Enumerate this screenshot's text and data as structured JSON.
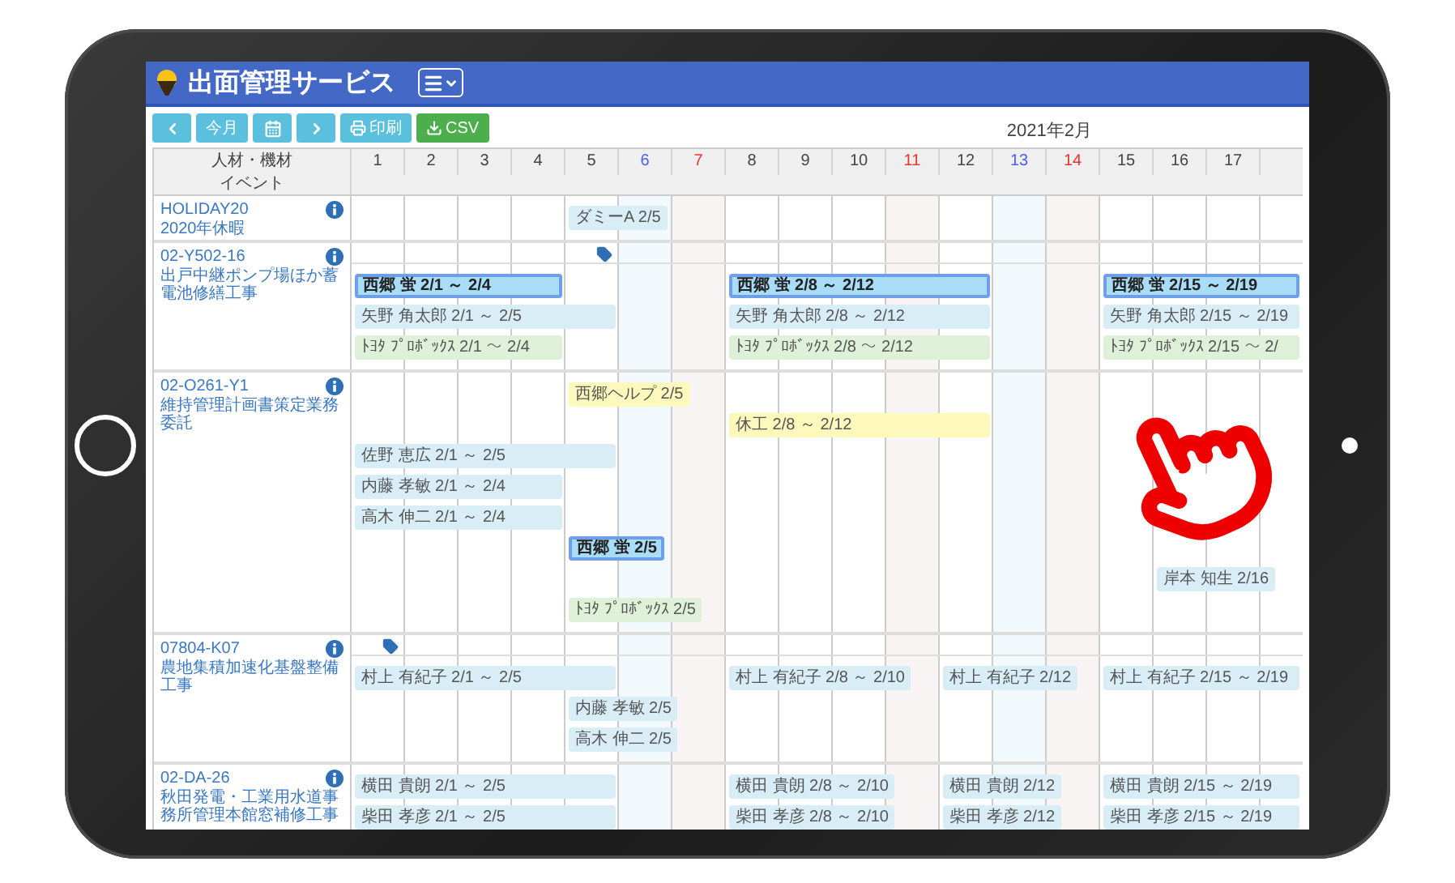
{
  "app": {
    "title": "出面管理サービス"
  },
  "toolbar": {
    "buttons": [
      {
        "kind": "prev"
      },
      {
        "kind": "text",
        "label": "今月"
      },
      {
        "kind": "calendar"
      },
      {
        "kind": "next"
      },
      {
        "kind": "print",
        "label": "印刷"
      },
      {
        "kind": "csv",
        "label": "CSV"
      }
    ],
    "month": "2021年2月"
  },
  "table": {
    "resource_header": "人材・機材",
    "event_header": "イベント",
    "days": [
      {
        "label": "1",
        "kind": "weekday"
      },
      {
        "label": "2",
        "kind": "weekday"
      },
      {
        "label": "3",
        "kind": "weekday"
      },
      {
        "label": "4",
        "kind": "weekday"
      },
      {
        "label": "5",
        "kind": "weekday"
      },
      {
        "label": "6",
        "kind": "saturday"
      },
      {
        "label": "7",
        "kind": "sunday"
      },
      {
        "label": "8",
        "kind": "weekday"
      },
      {
        "label": "9",
        "kind": "weekday"
      },
      {
        "label": "10",
        "kind": "weekday"
      },
      {
        "label": "11",
        "kind": "holiday"
      },
      {
        "label": "12",
        "kind": "weekday"
      },
      {
        "label": "13",
        "kind": "saturday"
      },
      {
        "label": "14",
        "kind": "sunday"
      },
      {
        "label": "15",
        "kind": "weekday"
      },
      {
        "label": "16",
        "kind": "weekday"
      },
      {
        "label": "17",
        "kind": "weekday"
      }
    ],
    "projects": [
      {
        "code": "HOLIDAY20",
        "name": "2020年休暇",
        "lanes": [
          [
            {
              "kind": "gap"
            },
            {
              "kind": "gap"
            },
            {
              "kind": "gap"
            },
            {
              "kind": "gap"
            },
            {
              "text": "ダミーA 2/5",
              "kind": "staff"
            }
          ]
        ]
      },
      {
        "code": "02-Y502-16",
        "name": "出戸中継ポンプ場ほか蓄電池修繕工事",
        "tag_row": [
          {
            "kind": "gap"
          },
          {
            "kind": "gap"
          },
          {
            "kind": "gap"
          },
          {
            "kind": "gap"
          },
          {
            "kind": "tag"
          }
        ],
        "lanes": [
          [
            {
              "text": "西郷 蛍 2/1 ～ 2/4",
              "kind": "lead"
            },
            {
              "kind": "continued"
            },
            {
              "kind": "continued"
            },
            {
              "kind": "continued"
            },
            {
              "kind": "gap"
            },
            {
              "kind": "gap"
            },
            {
              "kind": "gap"
            },
            {
              "text": "西郷 蛍 2/8 ～ 2/12",
              "kind": "lead"
            },
            {
              "kind": "continued"
            },
            {
              "kind": "continued"
            },
            {
              "kind": "continued"
            },
            {
              "kind": "continued"
            },
            {
              "kind": "gap"
            },
            {
              "kind": "gap"
            },
            {
              "text": "西郷 蛍 2/15 ～ 2/19",
              "kind": "lead"
            },
            {
              "kind": "continued"
            },
            {
              "kind": "continued"
            },
            {
              "kind": "continued"
            }
          ],
          [
            {
              "text": "矢野 角太郎 2/1 ～ 2/5",
              "kind": "staff"
            },
            {
              "kind": "continued"
            },
            {
              "kind": "continued"
            },
            {
              "kind": "continued"
            },
            {
              "kind": "continued"
            },
            {
              "kind": "gap"
            },
            {
              "kind": "gap"
            },
            {
              "text": "矢野 角太郎 2/8 ～ 2/12",
              "kind": "staff"
            },
            {
              "kind": "continued"
            },
            {
              "kind": "continued"
            },
            {
              "kind": "continued"
            },
            {
              "kind": "continued"
            },
            {
              "kind": "gap"
            },
            {
              "kind": "gap"
            },
            {
              "text": "矢野 角太郎 2/15 ～ 2/19",
              "kind": "staff"
            },
            {
              "kind": "continued"
            },
            {
              "kind": "continued"
            },
            {
              "kind": "continued"
            }
          ],
          [
            {
              "text": "ﾄﾖﾀ ﾌﾟﾛﾎﾞｯｸｽ 2/1 ～ 2/4",
              "kind": "equipment"
            },
            {
              "kind": "continued"
            },
            {
              "kind": "continued"
            },
            {
              "kind": "continued"
            },
            {
              "kind": "gap"
            },
            {
              "kind": "gap"
            },
            {
              "kind": "gap"
            },
            {
              "text": "ﾄﾖﾀ ﾌﾟﾛﾎﾞｯｸｽ 2/8 ～ 2/12",
              "kind": "equipment"
            },
            {
              "kind": "continued"
            },
            {
              "kind": "continued"
            },
            {
              "kind": "continued"
            },
            {
              "kind": "continued"
            },
            {
              "kind": "gap"
            },
            {
              "kind": "gap"
            },
            {
              "text": "ﾄﾖﾀ ﾌﾟﾛﾎﾞｯｸｽ 2/15 ～ 2/",
              "kind": "equipment"
            },
            {
              "kind": "continued"
            },
            {
              "kind": "continued"
            },
            {
              "kind": "continued"
            }
          ]
        ]
      },
      {
        "code": "02-O261-Y1",
        "name": "維持管理計画書策定業務委託",
        "lanes": [
          [
            {
              "kind": "gap"
            },
            {
              "kind": "gap"
            },
            {
              "kind": "gap"
            },
            {
              "kind": "gap"
            },
            {
              "text": "西郷ヘルプ 2/5",
              "kind": "notice"
            }
          ],
          [
            {
              "kind": "gap"
            },
            {
              "kind": "gap"
            },
            {
              "kind": "gap"
            },
            {
              "kind": "gap"
            },
            {
              "kind": "gap"
            },
            {
              "kind": "gap"
            },
            {
              "kind": "gap"
            },
            {
              "text": "休工 2/8 ～ 2/12",
              "kind": "notice"
            },
            {
              "kind": "continued"
            },
            {
              "kind": "continued"
            },
            {
              "kind": "continued"
            },
            {
              "kind": "continued"
            }
          ],
          [
            {
              "text": "佐野 恵広 2/1 ～ 2/5",
              "kind": "staff"
            },
            {
              "kind": "continued"
            },
            {
              "kind": "continued"
            },
            {
              "kind": "continued"
            },
            {
              "kind": "continued"
            }
          ],
          [
            {
              "text": "内藤 孝敏 2/1 ～ 2/4",
              "kind": "staff"
            },
            {
              "kind": "continued"
            },
            {
              "kind": "continued"
            },
            {
              "kind": "continued"
            }
          ],
          [
            {
              "text": "高木 伸二 2/1 ～ 2/4",
              "kind": "staff"
            },
            {
              "kind": "continued"
            },
            {
              "kind": "continued"
            },
            {
              "kind": "continued"
            }
          ],
          [
            {
              "kind": "gap"
            },
            {
              "kind": "gap"
            },
            {
              "kind": "gap"
            },
            {
              "kind": "gap"
            },
            {
              "text": "西郷 蛍 2/5",
              "kind": "lead"
            }
          ],
          [
            {
              "kind": "gap"
            },
            {
              "kind": "gap"
            },
            {
              "kind": "gap"
            },
            {
              "kind": "gap"
            },
            {
              "kind": "gap"
            },
            {
              "kind": "gap"
            },
            {
              "kind": "gap"
            },
            {
              "kind": "gap"
            },
            {
              "kind": "gap"
            },
            {
              "kind": "gap"
            },
            {
              "kind": "gap"
            },
            {
              "kind": "gap"
            },
            {
              "kind": "gap"
            },
            {
              "kind": "gap"
            },
            {
              "kind": "gap"
            },
            {
              "text": "岸本 知生 2/16",
              "kind": "staff"
            }
          ],
          [
            {
              "kind": "gap"
            },
            {
              "kind": "gap"
            },
            {
              "kind": "gap"
            },
            {
              "kind": "gap"
            },
            {
              "text": "ﾄﾖﾀ ﾌﾟﾛﾎﾞｯｸｽ 2/5",
              "kind": "equipment"
            }
          ]
        ]
      },
      {
        "code": "07804-K07",
        "name": "農地集積加速化基盤整備工事",
        "tag_row": [
          {
            "kind": "tag"
          }
        ],
        "lanes": [
          [
            {
              "text": "村上 有紀子 2/1 ～ 2/5",
              "kind": "staff"
            },
            {
              "kind": "continued"
            },
            {
              "kind": "continued"
            },
            {
              "kind": "continued"
            },
            {
              "kind": "continued"
            },
            {
              "kind": "gap"
            },
            {
              "kind": "gap"
            },
            {
              "text": "村上 有紀子 2/8 ～ 2/10",
              "kind": "staff"
            },
            {
              "kind": "continued"
            },
            {
              "kind": "continued"
            },
            {
              "kind": "gap"
            },
            {
              "text": "村上 有紀子 2/12",
              "kind": "staff"
            },
            {
              "kind": "gap"
            },
            {
              "kind": "gap"
            },
            {
              "text": "村上 有紀子 2/15 ～ 2/19",
              "kind": "staff"
            },
            {
              "kind": "continued"
            },
            {
              "kind": "continued"
            },
            {
              "kind": "continued"
            }
          ],
          [
            {
              "kind": "gap"
            },
            {
              "kind": "gap"
            },
            {
              "kind": "gap"
            },
            {
              "kind": "gap"
            },
            {
              "text": "内藤 孝敏 2/5",
              "kind": "staff"
            }
          ],
          [
            {
              "kind": "gap"
            },
            {
              "kind": "gap"
            },
            {
              "kind": "gap"
            },
            {
              "kind": "gap"
            },
            {
              "text": "高木 伸二 2/5",
              "kind": "staff"
            }
          ]
        ]
      },
      {
        "code": "02-DA-26",
        "name": "秋田発電・工業用水道事務所管理本館窓補修工事",
        "lanes": [
          [
            {
              "text": "横田 貴朗 2/1 ～ 2/5",
              "kind": "staff"
            },
            {
              "kind": "continued"
            },
            {
              "kind": "continued"
            },
            {
              "kind": "continued"
            },
            {
              "kind": "continued"
            },
            {
              "kind": "gap"
            },
            {
              "kind": "gap"
            },
            {
              "text": "横田 貴朗 2/8 ～ 2/10",
              "kind": "staff"
            },
            {
              "kind": "continued"
            },
            {
              "kind": "continued"
            },
            {
              "kind": "gap"
            },
            {
              "text": "横田 貴朗 2/12",
              "kind": "staff"
            },
            {
              "kind": "gap"
            },
            {
              "kind": "gap"
            },
            {
              "text": "横田 貴朗 2/15 ～ 2/19",
              "kind": "staff"
            },
            {
              "kind": "continued"
            },
            {
              "kind": "continued"
            },
            {
              "kind": "continued"
            }
          ],
          [
            {
              "text": "柴田 孝彦 2/1 ～ 2/5",
              "kind": "staff"
            },
            {
              "kind": "continued"
            },
            {
              "kind": "continued"
            },
            {
              "kind": "continued"
            },
            {
              "kind": "continued"
            },
            {
              "kind": "gap"
            },
            {
              "kind": "gap"
            },
            {
              "text": "柴田 孝彦 2/8 ～ 2/10",
              "kind": "staff"
            },
            {
              "kind": "continued"
            },
            {
              "kind": "continued"
            },
            {
              "kind": "gap"
            },
            {
              "text": "柴田 孝彦 2/12",
              "kind": "staff"
            },
            {
              "kind": "gap"
            },
            {
              "kind": "gap"
            },
            {
              "text": "柴田 孝彦 2/15 ～ 2/19",
              "kind": "staff"
            },
            {
              "kind": "continued"
            },
            {
              "kind": "continued"
            },
            {
              "kind": "continued"
            }
          ]
        ]
      }
    ]
  }
}
